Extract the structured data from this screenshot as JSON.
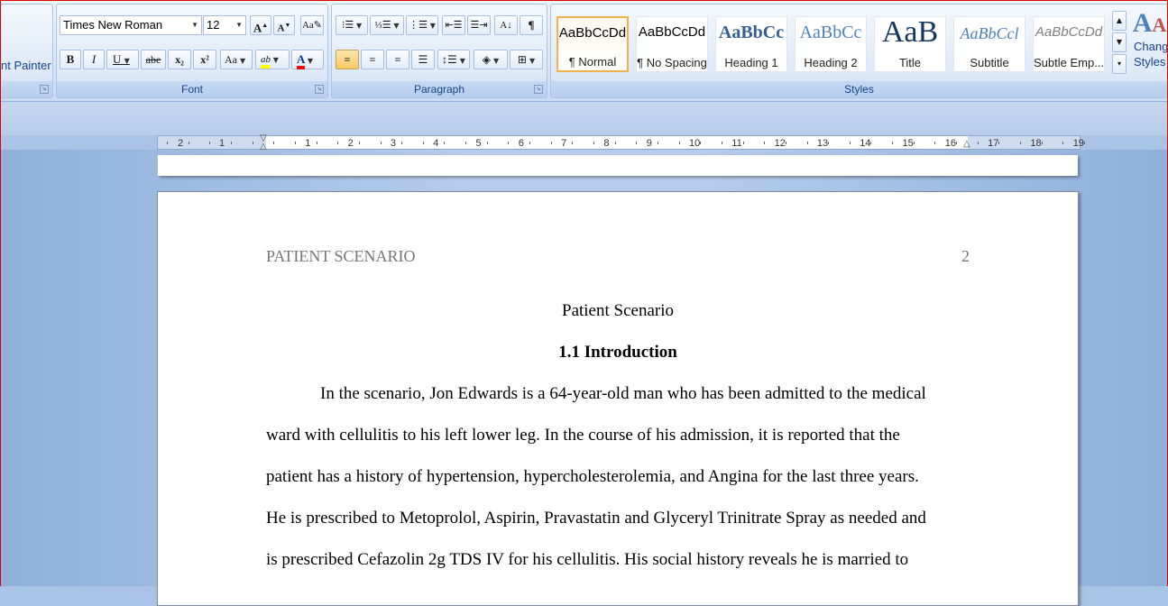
{
  "clipboard": {
    "format_painter": "nt Painter"
  },
  "font": {
    "name": "Times New Roman",
    "size": "12",
    "label": "Font",
    "grow": "A",
    "shrink": "A",
    "bold": "B",
    "italic": "I",
    "underline": "U",
    "strike": "abe",
    "subscript": "x₂",
    "superscript": "x²",
    "change_case": "Aa",
    "highlight": "ab",
    "font_color": "A"
  },
  "paragraph": {
    "label": "Paragraph",
    "show_marks": "¶",
    "sort": "A↓"
  },
  "styles": {
    "label": "Styles",
    "items": [
      {
        "sample": "AaBbCcDd",
        "name": "¶ Normal"
      },
      {
        "sample": "AaBbCcDd",
        "name": "¶ No Spacing"
      },
      {
        "sample": "AaBbCc",
        "name": "Heading 1"
      },
      {
        "sample": "AaBbCc",
        "name": "Heading 2"
      },
      {
        "sample": "AaB",
        "name": "Title"
      },
      {
        "sample": "AaBbCcl",
        "name": "Subtitle"
      },
      {
        "sample": "AaBbCcDd",
        "name": "Subtle Emp..."
      }
    ],
    "change_styles_line1": "Chang",
    "change_styles_line2": "Styles"
  },
  "ruler": {
    "left_numbers": [
      "2",
      "1"
    ],
    "numbers": [
      "1",
      "2",
      "3",
      "4",
      "5",
      "6",
      "7",
      "8",
      "9",
      "10",
      "11",
      "12",
      "13",
      "14",
      "15",
      "16",
      "17",
      "18",
      "19"
    ]
  },
  "document": {
    "header_left": "PATIENT SCENARIO",
    "header_page": "2",
    "title": "Patient Scenario",
    "heading": "1.1 Introduction",
    "lines": [
      "In the scenario, Jon Edwards is a 64-year-old man who has been admitted to the medical",
      "ward with cellulitis to his left lower leg. In the course of his admission, it is reported that the",
      "patient has a history of hypertension, hypercholesterolemia, and Angina for the last three years.",
      "He is prescribed to Metoprolol, Aspirin, Pravastatin and Glyceryl Trinitrate Spray as needed and",
      "is prescribed Cefazolin 2g TDS IV for his cellulitis. His social history reveals he is married to"
    ]
  },
  "colors": {
    "highlight": "#ffff00",
    "font_color": "#ff0000",
    "accent": "#15428b"
  }
}
